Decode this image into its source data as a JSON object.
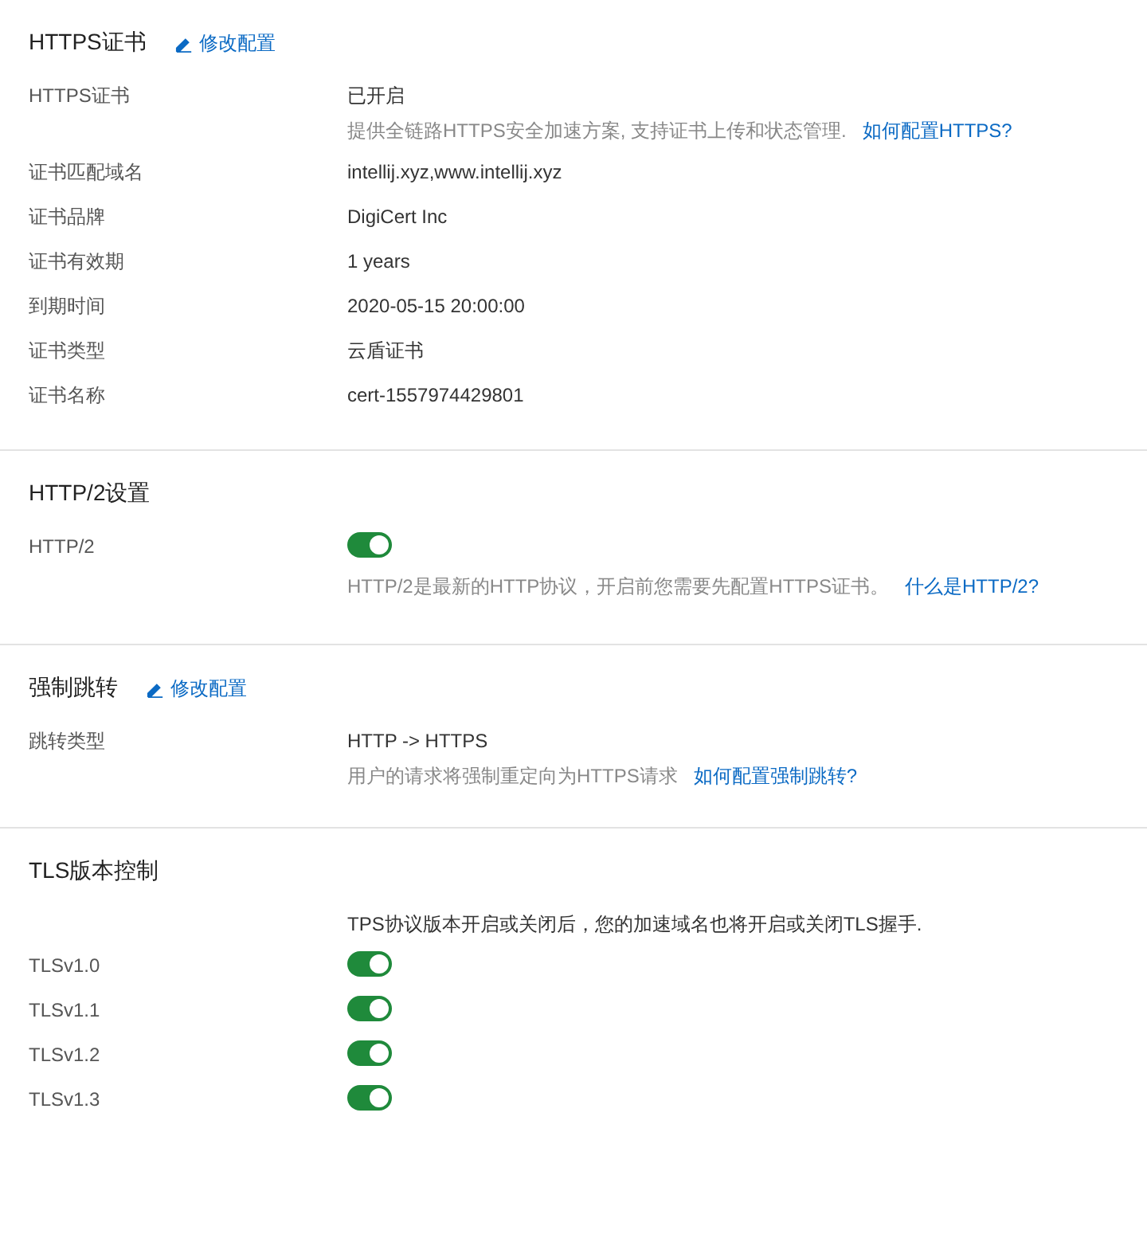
{
  "sections": [
    {
      "title": "HTTPS证书",
      "edit_link": "修改配置",
      "rows": [
        {
          "kind": "text",
          "label": "HTTPS证书",
          "value": "已开启",
          "note": "提供全链路HTTPS安全加速方案, 支持证书上传和状态管理.",
          "link": "如何配置HTTPS?"
        },
        {
          "kind": "text",
          "label": "证书匹配域名",
          "value": "intellij.xyz,www.intellij.xyz"
        },
        {
          "kind": "text",
          "label": "证书品牌",
          "value": "DigiCert Inc"
        },
        {
          "kind": "text",
          "label": "证书有效期",
          "value": "1 years"
        },
        {
          "kind": "text",
          "label": "到期时间",
          "value": "2020-05-15 20:00:00"
        },
        {
          "kind": "text",
          "label": "证书类型",
          "value": "云盾证书"
        },
        {
          "kind": "text",
          "label": "证书名称",
          "value": "cert-1557974429801"
        }
      ]
    },
    {
      "title": "HTTP/2设置",
      "rows": [
        {
          "kind": "toggle",
          "label": "HTTP/2",
          "on": true,
          "note": "HTTP/2是最新的HTTP协议，开启前您需要先配置HTTPS证书。",
          "link": "什么是HTTP/2?"
        }
      ]
    },
    {
      "title": "强制跳转",
      "edit_link": "修改配置",
      "rows": [
        {
          "kind": "text",
          "label": "跳转类型",
          "value": "HTTP -> HTTPS",
          "note": "用户的请求将强制重定向为HTTPS请求",
          "link": "如何配置强制跳转?"
        }
      ]
    },
    {
      "title": "TLS版本控制",
      "rows": [
        {
          "kind": "info",
          "value": "TPS协议版本开启或关闭后，您的加速域名也将开启或关闭TLS握手."
        },
        {
          "kind": "toggle",
          "label": "TLSv1.0",
          "on": true
        },
        {
          "kind": "toggle",
          "label": "TLSv1.1",
          "on": true
        },
        {
          "kind": "toggle",
          "label": "TLSv1.2",
          "on": true
        },
        {
          "kind": "toggle",
          "label": "TLSv1.3",
          "on": true
        }
      ]
    }
  ]
}
